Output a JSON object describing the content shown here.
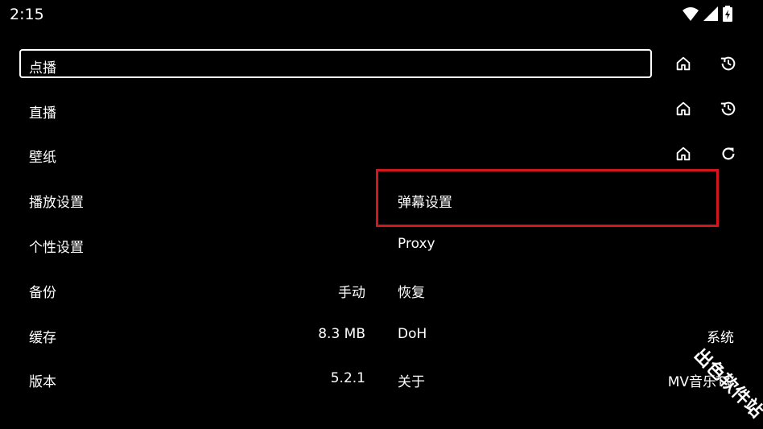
{
  "status": {
    "time": "2:15"
  },
  "menu": [
    {
      "label": "点播"
    },
    {
      "label": "直播"
    },
    {
      "label": "壁纸"
    },
    {
      "label": "播放设置"
    },
    {
      "label": "个性设置"
    },
    {
      "label": "备份",
      "value": "手动"
    },
    {
      "label": "缓存",
      "value": "8.3 MB"
    },
    {
      "label": "版本",
      "value": "5.2.1"
    }
  ],
  "right_menu": [
    {
      "label": "弹幕设置"
    },
    {
      "label": "Proxy"
    },
    {
      "label": "恢复"
    },
    {
      "label": "DoH",
      "value": "系统"
    },
    {
      "label": "关于",
      "value": "MV音乐TV"
    }
  ],
  "icons": {
    "home": "home-icon",
    "history": "history-icon",
    "refresh": "refresh-icon"
  },
  "watermark": "出色软件站",
  "colors": {
    "highlight": "#d3161b",
    "background": "#000000",
    "text": "#ffffff"
  }
}
